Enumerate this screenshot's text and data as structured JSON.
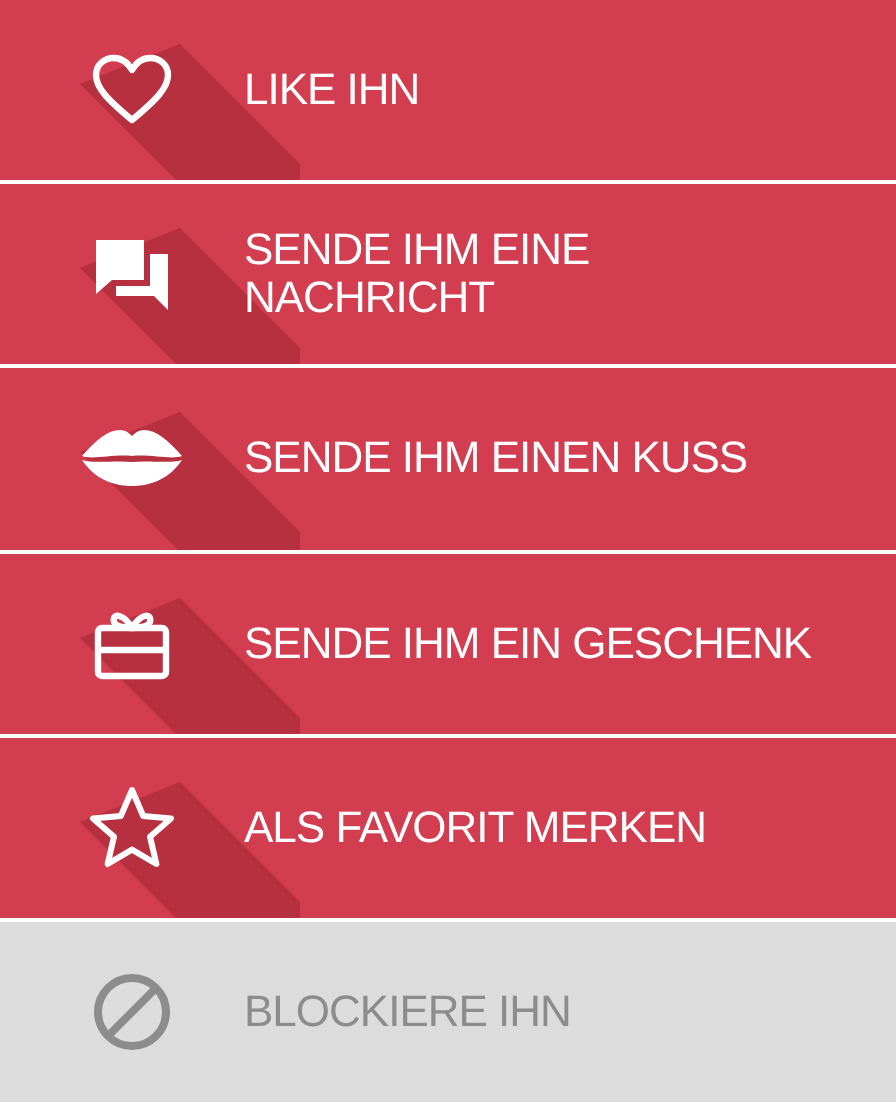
{
  "menu": [
    {
      "kind": "heart",
      "label": "LIKE IHN",
      "disabled": false
    },
    {
      "kind": "chat",
      "label": "SENDE IHM EINE NACHRICHT",
      "disabled": false
    },
    {
      "kind": "kiss",
      "label": "SENDE IHM EINEN KUSS",
      "disabled": false
    },
    {
      "kind": "gift",
      "label": "SENDE IHM EIN GESCHENK",
      "disabled": false
    },
    {
      "kind": "star",
      "label": "ALS FAVORIT MERKEN",
      "disabled": false
    },
    {
      "kind": "block",
      "label": "BLOCKIERE IHN",
      "disabled": true
    }
  ]
}
